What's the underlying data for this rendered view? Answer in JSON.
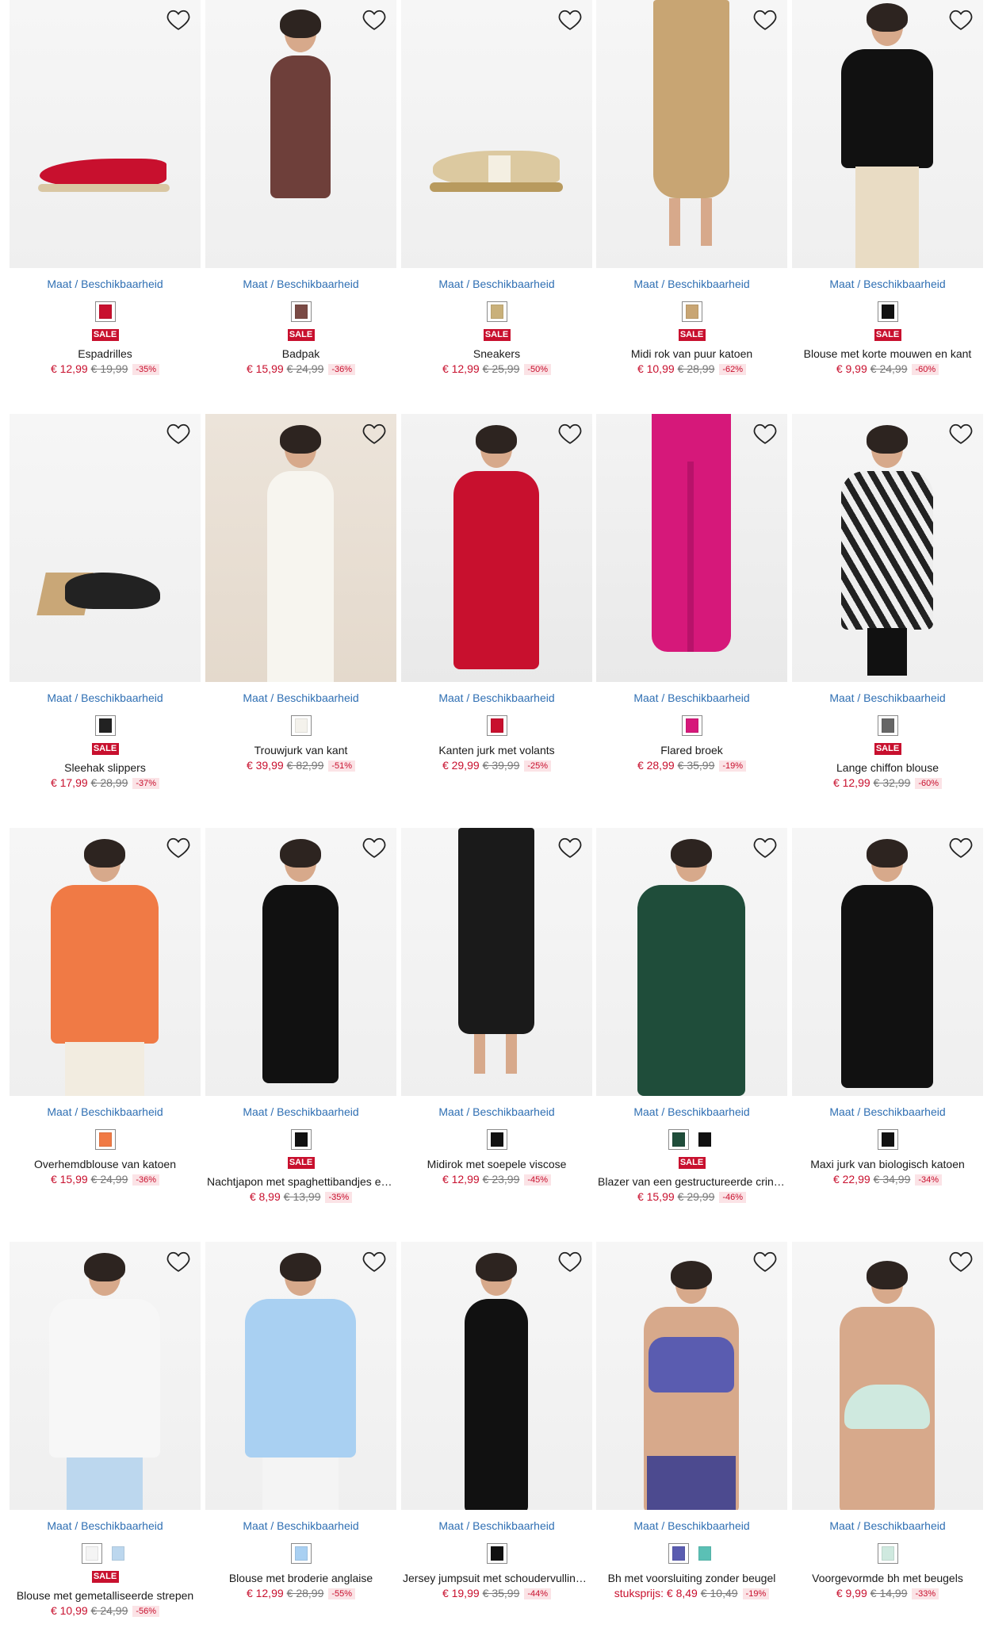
{
  "availability_label": "Maat / Beschikbaarheid",
  "sale_label": "SALE",
  "products": [
    {
      "name": "Espadrilles",
      "price": "€ 12,99",
      "old_price": "€ 19,99",
      "discount": "-35%",
      "sale": true,
      "image": "red-espadrille-shoe",
      "swatches": [
        "#c8102e"
      ]
    },
    {
      "name": "Badpak",
      "price": "€ 15,99",
      "old_price": "€ 24,99",
      "discount": "-36%",
      "sale": true,
      "image": "brown-swimsuit-model",
      "swatches": [
        "#7a4a45"
      ]
    },
    {
      "name": "Sneakers",
      "price": "€ 12,99",
      "old_price": "€ 25,99",
      "discount": "-50%",
      "sale": true,
      "image": "gold-sneaker",
      "swatches": [
        "#c9b07a"
      ]
    },
    {
      "name": "Midi rok van puur katoen",
      "price": "€ 10,99",
      "old_price": "€ 28,99",
      "discount": "-62%",
      "sale": true,
      "image": "beige-midi-skirt",
      "swatches": [
        "#c8a573"
      ]
    },
    {
      "name": "Blouse met korte mouwen en kant",
      "price": "€ 9,99",
      "old_price": "€ 24,99",
      "discount": "-60%",
      "sale": true,
      "image": "black-lace-blouse",
      "swatches": [
        "#111111"
      ]
    },
    {
      "name": "Sleehak slippers",
      "price": "€ 17,99",
      "old_price": "€ 28,99",
      "discount": "-37%",
      "sale": true,
      "image": "black-wedge-slipper",
      "swatches": [
        "#222222"
      ]
    },
    {
      "name": "Trouwjurk van kant",
      "price": "€ 39,99",
      "old_price": "€ 82,99",
      "discount": "-51%",
      "sale": false,
      "image": "white-lace-wedding-dress",
      "swatches": [
        "#f4f2ec"
      ]
    },
    {
      "name": "Kanten jurk met volants",
      "price": "€ 29,99",
      "old_price": "€ 39,99",
      "discount": "-25%",
      "sale": false,
      "image": "red-lace-dress",
      "swatches": [
        "#c8102e"
      ]
    },
    {
      "name": "Flared broek",
      "price": "€ 28,99",
      "old_price": "€ 35,99",
      "discount": "-19%",
      "sale": false,
      "image": "pink-flared-trousers",
      "swatches": [
        "#d6187a"
      ]
    },
    {
      "name": "Lange chiffon blouse",
      "price": "€ 12,99",
      "old_price": "€ 32,99",
      "discount": "-60%",
      "sale": true,
      "image": "zebra-chiffon-blouse",
      "swatches": [
        "#666666"
      ]
    },
    {
      "name": "Overhemdblouse van katoen",
      "price": "€ 15,99",
      "old_price": "€ 24,99",
      "discount": "-36%",
      "sale": false,
      "image": "orange-cotton-blouse",
      "swatches": [
        "#f07a45"
      ]
    },
    {
      "name": "Nachtjapon met spaghettibandjes en kant",
      "price": "€ 8,99",
      "old_price": "€ 13,99",
      "discount": "-35%",
      "sale": true,
      "image": "black-nightdress",
      "swatches": [
        "#111111"
      ]
    },
    {
      "name": "Midirok met soepele viscose",
      "price": "€ 12,99",
      "old_price": "€ 23,99",
      "discount": "-45%",
      "sale": false,
      "image": "black-midi-skirt",
      "swatches": [
        "#111111"
      ]
    },
    {
      "name": "Blazer van een gestructureerde crinkle",
      "price": "€ 15,99",
      "old_price": "€ 29,99",
      "discount": "-46%",
      "sale": true,
      "image": "green-blazer",
      "swatches": [
        "#1f4d3a",
        "#111111"
      ]
    },
    {
      "name": "Maxi jurk van biologisch katoen",
      "price": "€ 22,99",
      "old_price": "€ 34,99",
      "discount": "-34%",
      "sale": false,
      "image": "black-maxi-dress",
      "swatches": [
        "#111111"
      ]
    },
    {
      "name": "Blouse met gemetalliseerde strepen",
      "price": "€ 10,99",
      "old_price": "€ 24,99",
      "discount": "-56%",
      "sale": true,
      "image": "white-striped-blouse",
      "swatches": [
        "#f4f4f4",
        "#bcd7ee"
      ]
    },
    {
      "name": "Blouse met broderie anglaise",
      "price": "€ 12,99",
      "old_price": "€ 28,99",
      "discount": "-55%",
      "sale": false,
      "image": "light-blue-blouse",
      "swatches": [
        "#a9d0f2"
      ]
    },
    {
      "name": "Jersey jumpsuit met schoudervullingen",
      "price": "€ 19,99",
      "old_price": "€ 35,99",
      "discount": "-44%",
      "sale": false,
      "image": "black-jersey-jumpsuit",
      "swatches": [
        "#111111"
      ]
    },
    {
      "name": "Bh met voorsluiting zonder beugel",
      "price_prefix": "stuksprijs:",
      "price": "€ 8,49",
      "old_price": "€ 10,49",
      "discount": "-19%",
      "sale": false,
      "image": "purple-sports-bra",
      "swatches": [
        "#5a5cb0",
        "#5bc0b5"
      ]
    },
    {
      "name": "Voorgevormde bh met beugels",
      "price": "€ 9,99",
      "old_price": "€ 14,99",
      "discount": "-33%",
      "sale": false,
      "image": "mint-padded-bra",
      "swatches": [
        "#cfe9df"
      ]
    }
  ]
}
